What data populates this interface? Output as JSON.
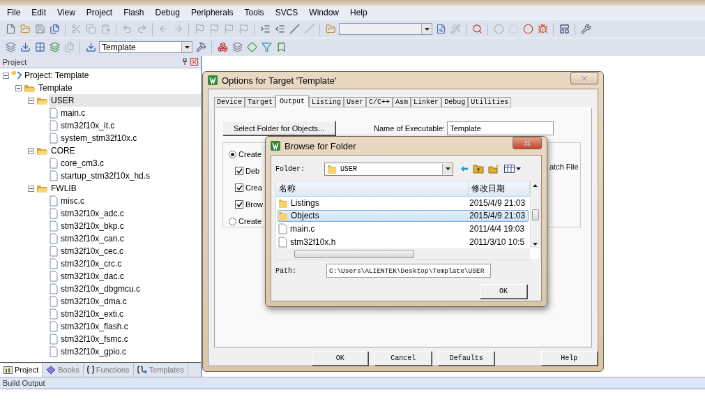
{
  "menu": [
    "File",
    "Edit",
    "View",
    "Project",
    "Flash",
    "Debug",
    "Peripherals",
    "Tools",
    "SVCS",
    "Window",
    "Help"
  ],
  "toolbar": {
    "target_value": "Template"
  },
  "project_panel": {
    "title": "Project",
    "tree": [
      {
        "label": "Project: Template",
        "kind": "project",
        "selected": false,
        "expanded": true,
        "children": [
          {
            "label": "Template",
            "kind": "target",
            "selected": false,
            "expanded": true,
            "children": [
              {
                "label": "USER",
                "kind": "group",
                "selected": true,
                "expanded": true,
                "children": [
                  {
                    "label": "main.c",
                    "kind": "file",
                    "selected": false
                  },
                  {
                    "label": "stm32f10x_it.c",
                    "kind": "file",
                    "selected": false
                  },
                  {
                    "label": "system_stm32f10x.c",
                    "kind": "file",
                    "selected": false
                  }
                ]
              },
              {
                "label": "CORE",
                "kind": "group",
                "selected": false,
                "expanded": true,
                "children": [
                  {
                    "label": "core_cm3.c",
                    "kind": "file",
                    "selected": false
                  },
                  {
                    "label": "startup_stm32f10x_hd.s",
                    "kind": "file",
                    "selected": false
                  }
                ]
              },
              {
                "label": "FWLIB",
                "kind": "group",
                "selected": false,
                "expanded": true,
                "children": [
                  {
                    "label": "misc.c",
                    "kind": "file",
                    "selected": false
                  },
                  {
                    "label": "stm32f10x_adc.c",
                    "kind": "file",
                    "selected": false
                  },
                  {
                    "label": "stm32f10x_bkp.c",
                    "kind": "file",
                    "selected": false
                  },
                  {
                    "label": "stm32f10x_can.c",
                    "kind": "file",
                    "selected": false
                  },
                  {
                    "label": "stm32f10x_cec.c",
                    "kind": "file",
                    "selected": false
                  },
                  {
                    "label": "stm32f10x_crc.c",
                    "kind": "file",
                    "selected": false
                  },
                  {
                    "label": "stm32f10x_dac.c",
                    "kind": "file",
                    "selected": false
                  },
                  {
                    "label": "stm32f10x_dbgmcu.c",
                    "kind": "file",
                    "selected": false
                  },
                  {
                    "label": "stm32f10x_dma.c",
                    "kind": "file",
                    "selected": false
                  },
                  {
                    "label": "stm32f10x_exti.c",
                    "kind": "file",
                    "selected": false
                  },
                  {
                    "label": "stm32f10x_flash.c",
                    "kind": "file",
                    "selected": false
                  },
                  {
                    "label": "stm32f10x_fsmc.c",
                    "kind": "file",
                    "selected": false
                  },
                  {
                    "label": "stm32f10x_gpio.c",
                    "kind": "file",
                    "selected": false
                  }
                ]
              }
            ]
          }
        ]
      }
    ],
    "tabs": [
      {
        "label": "Project",
        "kind": "project",
        "selected": true
      },
      {
        "label": "Books",
        "kind": "books",
        "selected": false
      },
      {
        "label": "Functions",
        "kind": "functions",
        "selected": false
      },
      {
        "label": "Templates",
        "kind": "templates",
        "selected": false
      }
    ]
  },
  "options_dialog": {
    "title": "Options for Target 'Template'",
    "tabs": [
      {
        "label": "Device",
        "selected": false
      },
      {
        "label": "Target",
        "selected": false
      },
      {
        "label": "Output",
        "selected": true
      },
      {
        "label": "Listing",
        "selected": false
      },
      {
        "label": "User",
        "selected": false
      },
      {
        "label": "C/C++",
        "selected": false
      },
      {
        "label": "Asm",
        "selected": false
      },
      {
        "label": "Linker",
        "selected": false
      },
      {
        "label": "Debug",
        "selected": false
      },
      {
        "label": "Utilities",
        "selected": false
      }
    ],
    "select_folder_button": "Select Folder for Objects...",
    "executable_label": "Name of Executable:",
    "executable_value": "Template",
    "options": [
      {
        "kind": "radio",
        "label": "Create",
        "checked": true
      },
      {
        "kind": "checkbox",
        "label": "Deb",
        "checked": true
      },
      {
        "kind": "checkbox",
        "label": "Crea",
        "checked": true
      },
      {
        "kind": "checkbox",
        "label": "Brow",
        "checked": true
      },
      {
        "kind": "radio",
        "label": "Create",
        "checked": false
      }
    ],
    "right_text": "atch File",
    "buttons": [
      "OK",
      "Cancel",
      "Defaults",
      "Help"
    ]
  },
  "browse_dialog": {
    "title": "Browse for Folder",
    "folder_label": "Folder:",
    "folder_value": "USER",
    "columns": [
      "名称",
      "修改日期"
    ],
    "rows": [
      {
        "kind": "folder",
        "name": "Listings",
        "date": "2015/4/9 21:03",
        "selected": false
      },
      {
        "kind": "folder",
        "name": "Objects",
        "date": "2015/4/9 21:03",
        "selected": true
      },
      {
        "kind": "file",
        "name": "main.c",
        "date": "2011/4/4 19:03",
        "selected": false
      },
      {
        "kind": "file",
        "name": "stm32f10x.h",
        "date": "2011/3/10 10:5",
        "selected": false
      }
    ],
    "path_label": "Path:",
    "path_value": "C:\\Users\\ALIENTEK\\Desktop\\Template\\USER",
    "ok_button": "OK"
  },
  "build_output": {
    "title": "Build Output"
  }
}
